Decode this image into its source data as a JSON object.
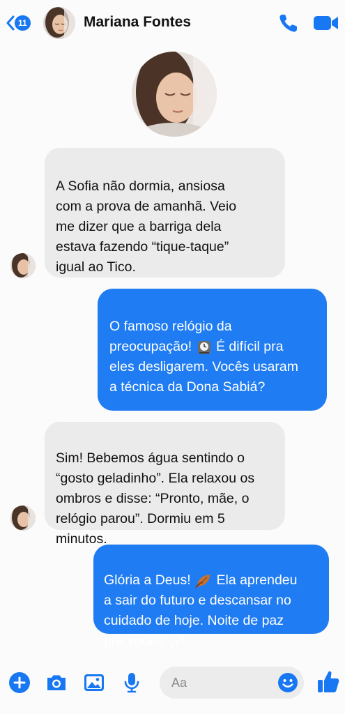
{
  "header": {
    "back_badge": "11",
    "contact_name": "Mariana Fontes"
  },
  "messages": [
    {
      "direction": "incoming",
      "text": "A Sofia não dormia, ansiosa\ncom a prova de amanhã. Veio\nme dizer que a barriga dela\nestava fazendo “tique-taque”\nigual ao Tico."
    },
    {
      "direction": "outgoing",
      "text_before_emoji": "O famoso relógio da\npreocupação! ",
      "emoji": "mantel-clock-icon",
      "text_after_emoji": " É difícil pra\neles desligarem. Vocês usaram\na técnica da Dona Sabiá?"
    },
    {
      "direction": "incoming",
      "text": "Sim! Bebemos água sentindo o\n“gosto geladinho”. Ela relaxou os\nombros e disse: “Pronto, mãe, o\nrelógio parou”. Dormiu em 5\nminutos."
    },
    {
      "direction": "outgoing",
      "text_before_emoji": "Glória a Deus! ",
      "emoji": "leaves-icon",
      "text_after_emoji": " Ela aprendeu\na sair do futuro e descansar no\ncuidado de hoje. Noite de paz\npra vocês! ",
      "emoji_end": "zzz-icon"
    }
  ],
  "composer": {
    "placeholder": "Aa"
  },
  "colors": {
    "accent": "#1877f2",
    "outgoing_bubble": "#1f7cf2",
    "incoming_bubble": "#ebebeb",
    "background": "#fbfbfb"
  }
}
